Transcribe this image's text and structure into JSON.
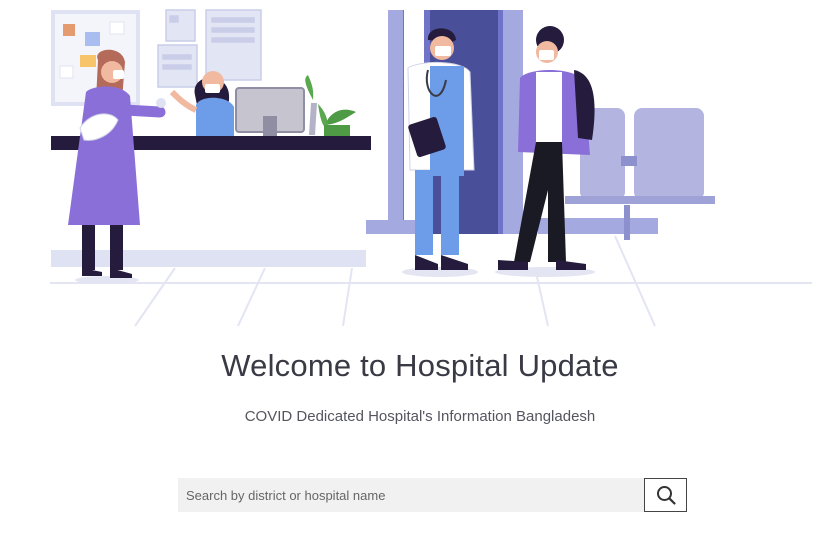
{
  "hero": {
    "illustration": "hospital-reception-illustration"
  },
  "main": {
    "title": "Welcome to Hospital Update",
    "subtitle": "COVID Dedicated Hospital's Information Bangladesh"
  },
  "search": {
    "placeholder": "Search by district or hospital name",
    "value": "",
    "button_icon": "search-icon"
  },
  "colors": {
    "accent_purple": "#8b6fd9",
    "scrubs_blue": "#6d9ce8",
    "floor_line": "#dfe2f2"
  }
}
